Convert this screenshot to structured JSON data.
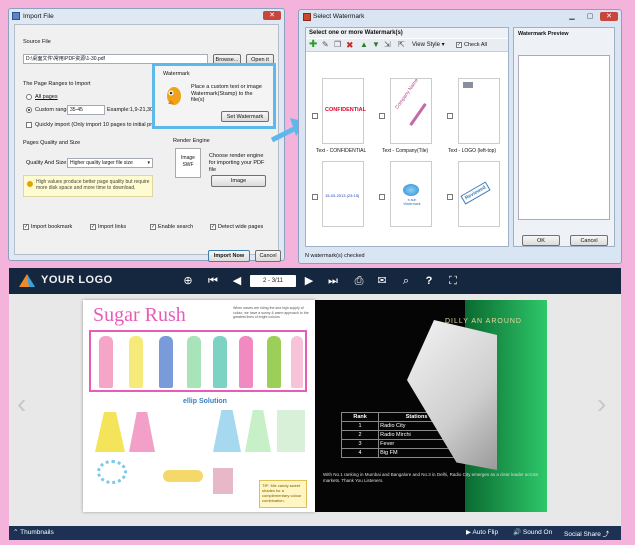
{
  "import_dialog": {
    "title": "Import File",
    "source_file_label": "Source File",
    "source_path": "D:\\桌面文件\\常用\\PDF资源\\1-30.pdf",
    "browse_label": "Browse...",
    "open_label": "Open it",
    "ranges_heading": "The Page Ranges to Import",
    "all_pages": "All pages",
    "custom_range": "Custom range:",
    "range_value": "35-45",
    "range_example": "Example:1,9-21,30",
    "quickly_import": "Quickly import (Only import 10 pages to initial preview)",
    "quality_heading": "Pages Quality and Size",
    "quality_label": "Quality And Size:",
    "quality_value": "Higher quality larger file size",
    "quality_hint": "High values produce better page quality but require more disk space and more time to download.",
    "watermark_heading": "Watermark",
    "watermark_desc": "Place a custom text or image Watermark(Stamp) to the file(s)",
    "set_watermark": "Set Watermark",
    "render_heading": "Render Engine",
    "render_desc": "Choose render engine for importing your PDF file",
    "image_label": "Image",
    "render_icon_text": "Image SWF",
    "import_bookmark": "Import bookmark",
    "import_links": "Import links",
    "enable_search": "Enable search",
    "detect_wide": "Detect wide pages",
    "import_now": "Import Now",
    "cancel": "Cancel"
  },
  "watermark_dialog": {
    "title": "Select Watermark",
    "header": "Select one or more Watermark(s)",
    "preview_header": "Watermark Preview",
    "view_style": "View Style",
    "check_all": "Check All",
    "items": [
      {
        "thumb": "CONFIDENTIAL",
        "label": "Text - CONFIDENTIAL"
      },
      {
        "thumb": "Company Name",
        "label": "Text - Company(Tile)"
      },
      {
        "thumb": "",
        "label": "Text - LOGO (left-top)"
      },
      {
        "thumb": "15-03-2013 (23:15)",
        "label": ""
      },
      {
        "thumb": "e-sun Watermark",
        "label": ""
      },
      {
        "thumb": "Reviewed",
        "label": ""
      }
    ],
    "status": "N watermark(s) checked",
    "ok": "OK",
    "cancel": "Cancel"
  },
  "viewer": {
    "logo": "YOUR LOGO",
    "page_indicator": "2 - 3/11",
    "thumbnails": "Thumbnails",
    "auto_flip": "Auto Flip",
    "sound_on": "Sound On",
    "social_share": "Social Share",
    "left_page": {
      "title": "Sugar Rush",
      "subtitle": "When waves are riding the sea high supply of colour, we have a sunny & warm approach to the greatest lines of bright colours",
      "brand": "ellip Solution",
      "tip": "TIP: Mix candy-sweet shades for a complementary colour combination."
    },
    "right_page": {
      "headline": "DILLY AN AROUND",
      "table_headers": [
        "Rank",
        "Stations"
      ],
      "table_rows": [
        [
          "1",
          "Radio City"
        ],
        [
          "2",
          "Radio Mirchi"
        ],
        [
          "3",
          "Fever"
        ],
        [
          "4",
          "Big FM"
        ]
      ],
      "footer": "With No.1 ranking in Mumbai and Bangalore and No.3 in Delhi, Radio City emerges as a clear leader across markets. Thank You Listeners."
    }
  }
}
